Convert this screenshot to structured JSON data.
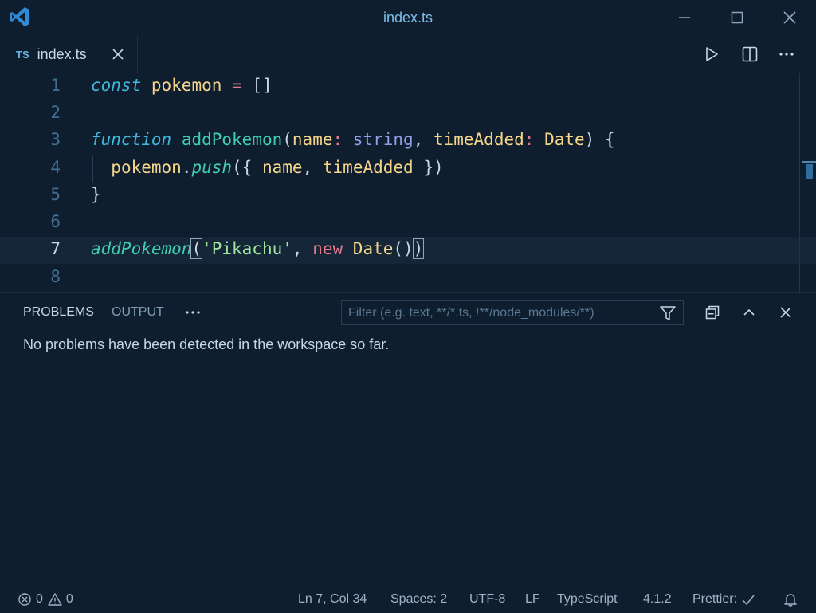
{
  "window": {
    "title": "index.ts"
  },
  "tab": {
    "badge": "TS",
    "label": "index.ts"
  },
  "editor": {
    "line_numbers": [
      "1",
      "2",
      "3",
      "4",
      "5",
      "6",
      "7",
      "8"
    ],
    "current_line": "7"
  },
  "panel": {
    "tabs": [
      "PROBLEMS",
      "OUTPUT"
    ],
    "more": "···",
    "filter_placeholder": "Filter (e.g. text, **/*.ts, !**/node_modules/**)",
    "message": "No problems have been detected in the workspace so far."
  },
  "status": {
    "errors": "0",
    "warnings": "0",
    "cursor": "Ln 7, Col 34",
    "spaces": "Spaces: 2",
    "encoding": "UTF-8",
    "eol": "LF",
    "language": "TypeScript",
    "version": "4.1.2",
    "prettier": "Prettier:"
  },
  "code": {
    "l1": {
      "kw": "const",
      "var": "pokemon",
      "op": "=",
      "pun": "[]"
    },
    "l3": {
      "kw": "function",
      "fn": "addPokemon",
      "p1": "name",
      "c1": ":",
      "t1": "string",
      "comma": ",",
      "p2": "timeAdded",
      "c2": ":",
      "t2": "Date",
      "close": ")",
      "brace": "{"
    },
    "l4": {
      "obj": "pokemon",
      "dot": ".",
      "method": "push",
      "open": "({",
      "a1": "name",
      "comma": ",",
      "a2": "timeAdded",
      "close": "})"
    },
    "l5": {
      "brace": "}"
    },
    "l7": {
      "fn": "addPokemon",
      "open": "(",
      "str": "'Pikachu'",
      "comma": ",",
      "new": "new",
      "cls": "Date",
      "call": "()",
      "close": ")"
    }
  },
  "colors": {
    "background": "#0f1e2e",
    "accent": "#7cbde6",
    "keyword": "#3fb7d9",
    "function": "#3fcfb0",
    "variable": "#f4d58a",
    "string": "#9fe6a0",
    "operator": "#e27a8a"
  },
  "icons": {
    "app": "vscode-logo-icon",
    "minimize": "minimize-icon",
    "maximize": "maximize-icon",
    "close": "close-icon",
    "run": "run-icon",
    "split": "split-editor-icon",
    "more": "more-actions-icon",
    "filter": "filter-icon",
    "collapse": "collapse-all-icon",
    "chevron": "chevron-up-icon",
    "error": "error-icon",
    "warning": "warning-icon",
    "check": "check-icon",
    "bell": "bell-icon"
  }
}
